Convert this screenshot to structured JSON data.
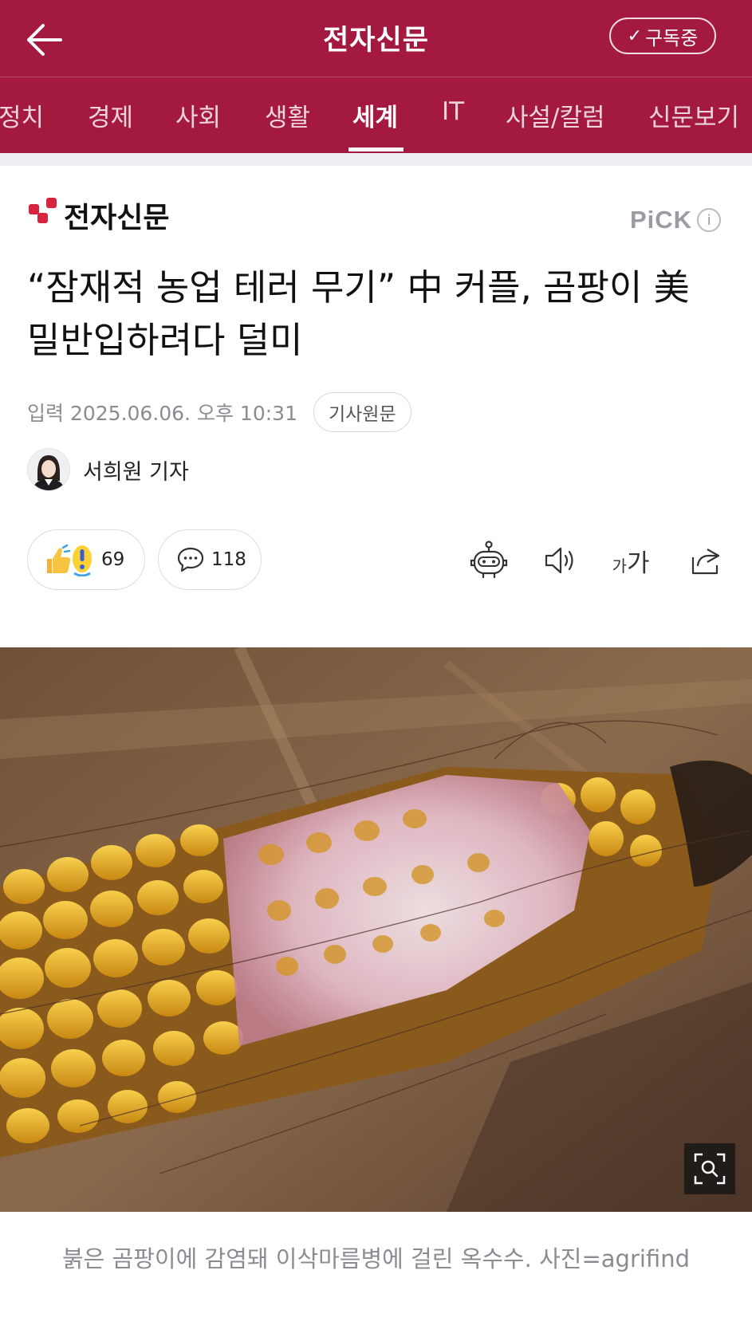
{
  "header": {
    "title": "전자신문",
    "subscribe_label": "구독중",
    "colors": {
      "brand": "#a3193f"
    }
  },
  "tabs": [
    {
      "label": "정치",
      "active": false
    },
    {
      "label": "경제",
      "active": false
    },
    {
      "label": "사회",
      "active": false
    },
    {
      "label": "생활",
      "active": false
    },
    {
      "label": "세계",
      "active": true
    },
    {
      "label": "IT",
      "active": false
    },
    {
      "label": "사설/칼럼",
      "active": false
    },
    {
      "label": "신문보기",
      "active": false
    }
  ],
  "article": {
    "press_name": "전자신문",
    "pick_label": "PiCK",
    "headline": "“잠재적 농업 테러 무기” 中 커플, 곰팡이 美 밀반입하려다 덜미",
    "meta": {
      "date": "입력 2025.06.06. 오후 10:31",
      "original_label": "기사원문"
    },
    "reporter": "서희원 기자",
    "reaction_count": "69",
    "comment_count": "118",
    "font_size_small": "가",
    "font_size_large": "가",
    "caption": "붉은 곰팡이에 감염돼 이삭마름병에 걸린 옥수수. 사진=agrifind"
  },
  "icons": [
    "back-arrow-icon",
    "check-icon",
    "info-icon",
    "reaction-icon",
    "comment-icon",
    "summary-bot-icon",
    "speaker-icon",
    "share-icon",
    "zoom-icon"
  ]
}
